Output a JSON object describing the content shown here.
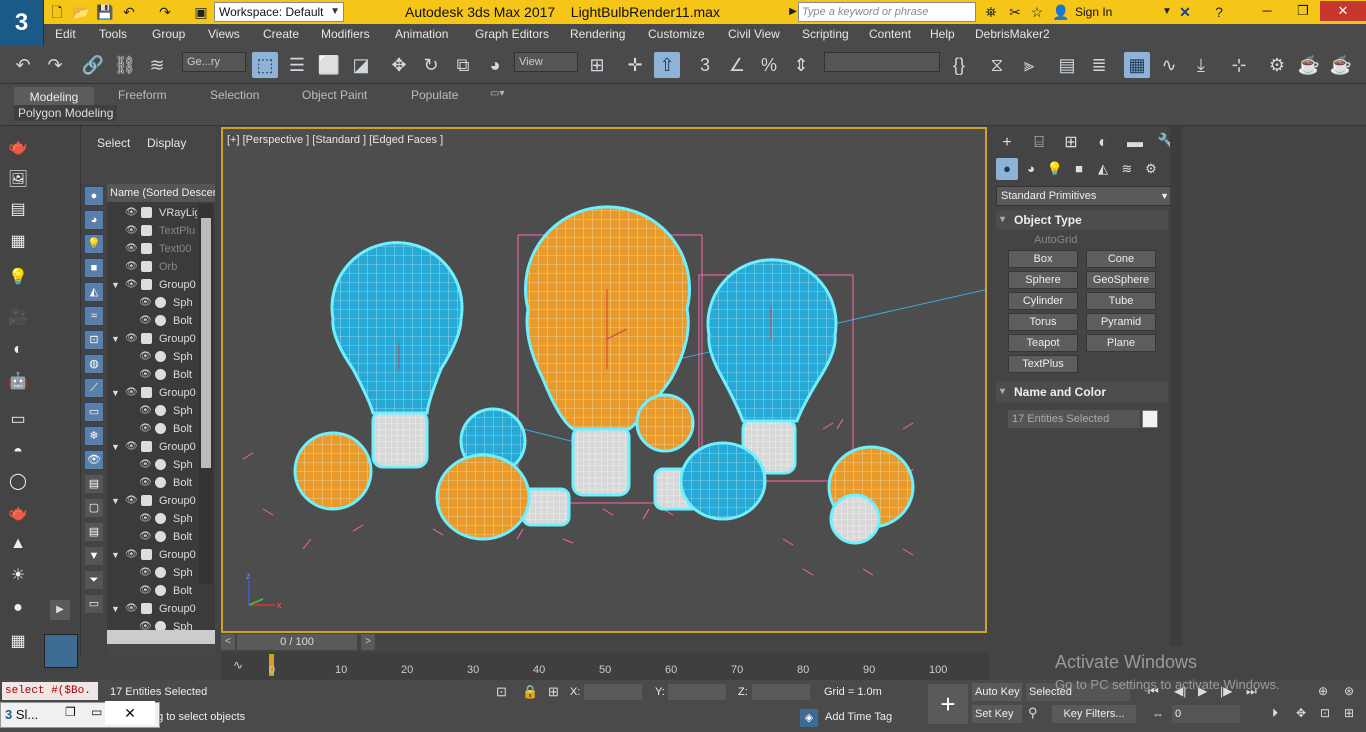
{
  "titlebar": {
    "app_title": "Autodesk 3ds Max 2017",
    "file_name": "LightBulbRender11.max",
    "workspace": "Workspace: Default",
    "search_placeholder": "Type a keyword or phrase",
    "sign_in": "Sign In"
  },
  "menu": [
    "Edit",
    "Tools",
    "Group",
    "Views",
    "Create",
    "Modifiers",
    "Animation",
    "Graph Editors",
    "Rendering",
    "Customize",
    "Civil View",
    "Scripting",
    "Content",
    "Help",
    "DebrisMaker2"
  ],
  "toolbar": {
    "selection_filter": "Ge...ry",
    "ref_coord": "View"
  },
  "ribbon": {
    "tabs": [
      "Modeling",
      "Freeform",
      "Selection",
      "Object Paint",
      "Populate"
    ],
    "active_tab": "Modeling",
    "panel": "Polygon Modeling"
  },
  "explorer": {
    "tabs": [
      "Select",
      "Display"
    ],
    "column_header": "Name (Sorted Descen",
    "rows": [
      {
        "name": "VRayLig",
        "expand": "",
        "level": 0
      },
      {
        "name": "TextPlu",
        "expand": "",
        "level": 0
      },
      {
        "name": "Text00",
        "expand": "",
        "level": 0
      },
      {
        "name": "Orb",
        "expand": "",
        "level": 0
      },
      {
        "name": "Group0",
        "expand": "▼",
        "level": 0
      },
      {
        "name": "Sph",
        "expand": "",
        "level": 1
      },
      {
        "name": "Bolt",
        "expand": "",
        "level": 1
      },
      {
        "name": "Group0",
        "expand": "▼",
        "level": 0
      },
      {
        "name": "Sph",
        "expand": "",
        "level": 1
      },
      {
        "name": "Bolt",
        "expand": "",
        "level": 1
      },
      {
        "name": "Group0",
        "expand": "▼",
        "level": 0
      },
      {
        "name": "Sph",
        "expand": "",
        "level": 1
      },
      {
        "name": "Bolt",
        "expand": "",
        "level": 1
      },
      {
        "name": "Group0",
        "expand": "▼",
        "level": 0
      },
      {
        "name": "Sph",
        "expand": "",
        "level": 1
      },
      {
        "name": "Bolt",
        "expand": "",
        "level": 1
      },
      {
        "name": "Group0",
        "expand": "▼",
        "level": 0
      },
      {
        "name": "Sph",
        "expand": "",
        "level": 1
      },
      {
        "name": "Bolt",
        "expand": "",
        "level": 1
      },
      {
        "name": "Group0",
        "expand": "▼",
        "level": 0
      },
      {
        "name": "Sph",
        "expand": "",
        "level": 1
      },
      {
        "name": "Bolt",
        "expand": "",
        "level": 1
      },
      {
        "name": "Group0",
        "expand": "▼",
        "level": 0
      },
      {
        "name": "Sph",
        "expand": "",
        "level": 1
      }
    ]
  },
  "viewport": {
    "label": "[+] [Perspective ] [Standard ] [Edged Faces ]",
    "colors": {
      "orange": "#e89a2a",
      "cyan": "#27a9d6",
      "wire": "#ffffff",
      "outline": "#6ff0ff",
      "bracket": "#ff66aa"
    }
  },
  "command_panel": {
    "primitive_type": "Standard Primitives",
    "object_type_title": "Object Type",
    "autogrid": "AutoGrid",
    "buttons": [
      "Box",
      "Cone",
      "Sphere",
      "GeoSphere",
      "Cylinder",
      "Tube",
      "Torus",
      "Pyramid",
      "Teapot",
      "Plane",
      "TextPlus"
    ],
    "name_color_title": "Name and Color",
    "name_field": "17 Entities Selected"
  },
  "timeline": {
    "frame": "0 / 100",
    "ticks": [
      "0",
      "10",
      "20",
      "30",
      "40",
      "50",
      "60",
      "70",
      "80",
      "90",
      "100"
    ]
  },
  "status": {
    "maxscript": "select #($Bo.",
    "selected": "17 Entities Selected",
    "prompt": "k-and-drag to select objects",
    "x_label": "X:",
    "y_label": "Y:",
    "z_label": "Z:",
    "grid": "Grid = 1.0m",
    "add_time_tag": "Add Time Tag",
    "auto_key": "Auto Key",
    "set_key": "Set Key",
    "key_mode": "Selected",
    "key_filters": "Key Filters...",
    "frame_field": "0",
    "taskbar": "Sl..."
  },
  "watermark": {
    "line1": "Activate Windows",
    "line2": "Go to PC settings to activate Windows."
  }
}
